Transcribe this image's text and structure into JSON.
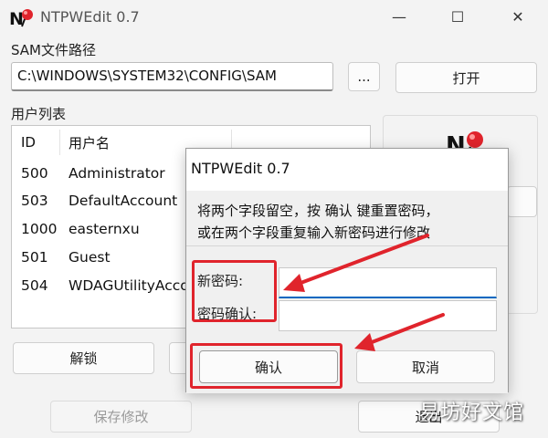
{
  "window": {
    "title": "NTPWEdit 0.7",
    "minimize_glyph": "—",
    "maximize_glyph": "☐",
    "close_glyph": "✕"
  },
  "sam": {
    "label": "SAM文件路径",
    "path_value": "C:\\WINDOWS\\SYSTEM32\\CONFIG\\SAM",
    "browse_label": "...",
    "open_label": "打开"
  },
  "users": {
    "label": "用户列表",
    "columns": [
      "ID",
      "用户名"
    ],
    "rows": [
      {
        "id": "500",
        "name": "Administrator"
      },
      {
        "id": "503",
        "name": "DefaultAccount"
      },
      {
        "id": "1000",
        "name": "easternxu"
      },
      {
        "id": "501",
        "name": "Guest"
      },
      {
        "id": "504",
        "name": "WDAGUtilityAccount"
      }
    ]
  },
  "buttons": {
    "unlock_label": "解锁",
    "save_label": "保存修改",
    "exit_label": "退出"
  },
  "dialog": {
    "title": "NTPWEdit 0.7",
    "message_line1": "将两个字段留空，按 确认 键重置密码，",
    "message_line2": "或在两个字段重复输入新密码进行修改",
    "new_password_label": "新密码:",
    "confirm_password_label": "密码确认:",
    "new_password_value": "",
    "confirm_password_value": "",
    "ok_label": "确认",
    "cancel_label": "取消"
  },
  "watermark": "易坊好文馆",
  "colors": {
    "annotation_red": "#e0242c",
    "focus_blue": "#0067c0",
    "logo_red": "#e0242c"
  }
}
